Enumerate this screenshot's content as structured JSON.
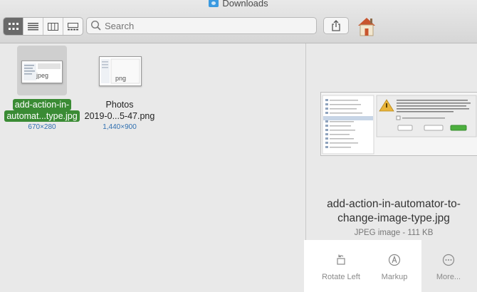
{
  "window": {
    "title": "Downloads"
  },
  "toolbar": {
    "views": [
      {
        "name": "icon-view",
        "active": true
      },
      {
        "name": "list-view",
        "active": false
      },
      {
        "name": "column-view",
        "active": false
      },
      {
        "name": "gallery-view",
        "active": false
      }
    ],
    "search_placeholder": "Search"
  },
  "files": [
    {
      "name_line1": "add-action-in-",
      "name_line2": "automat...type.jpg",
      "dims": "670×280",
      "badge": "jpeg",
      "selected": true
    },
    {
      "name_line1": "Photos",
      "name_line2": "2019-0...5-47.png",
      "dims": "1,440×900",
      "badge": "png",
      "selected": false
    }
  ],
  "preview": {
    "name_line1": "add-action-in-automator-to-",
    "name_line2": "change-image-type.jpg",
    "meta": "JPEG image - 111 KB"
  },
  "actions": [
    {
      "label": "Rotate Left",
      "icon": "rotate-left-icon"
    },
    {
      "label": "Markup",
      "icon": "markup-icon"
    },
    {
      "label": "More...",
      "icon": "more-icon"
    }
  ],
  "colors": {
    "selection": "#3a8b34",
    "dims": "#2f6fb0",
    "active_view": "#6a6a6a"
  }
}
